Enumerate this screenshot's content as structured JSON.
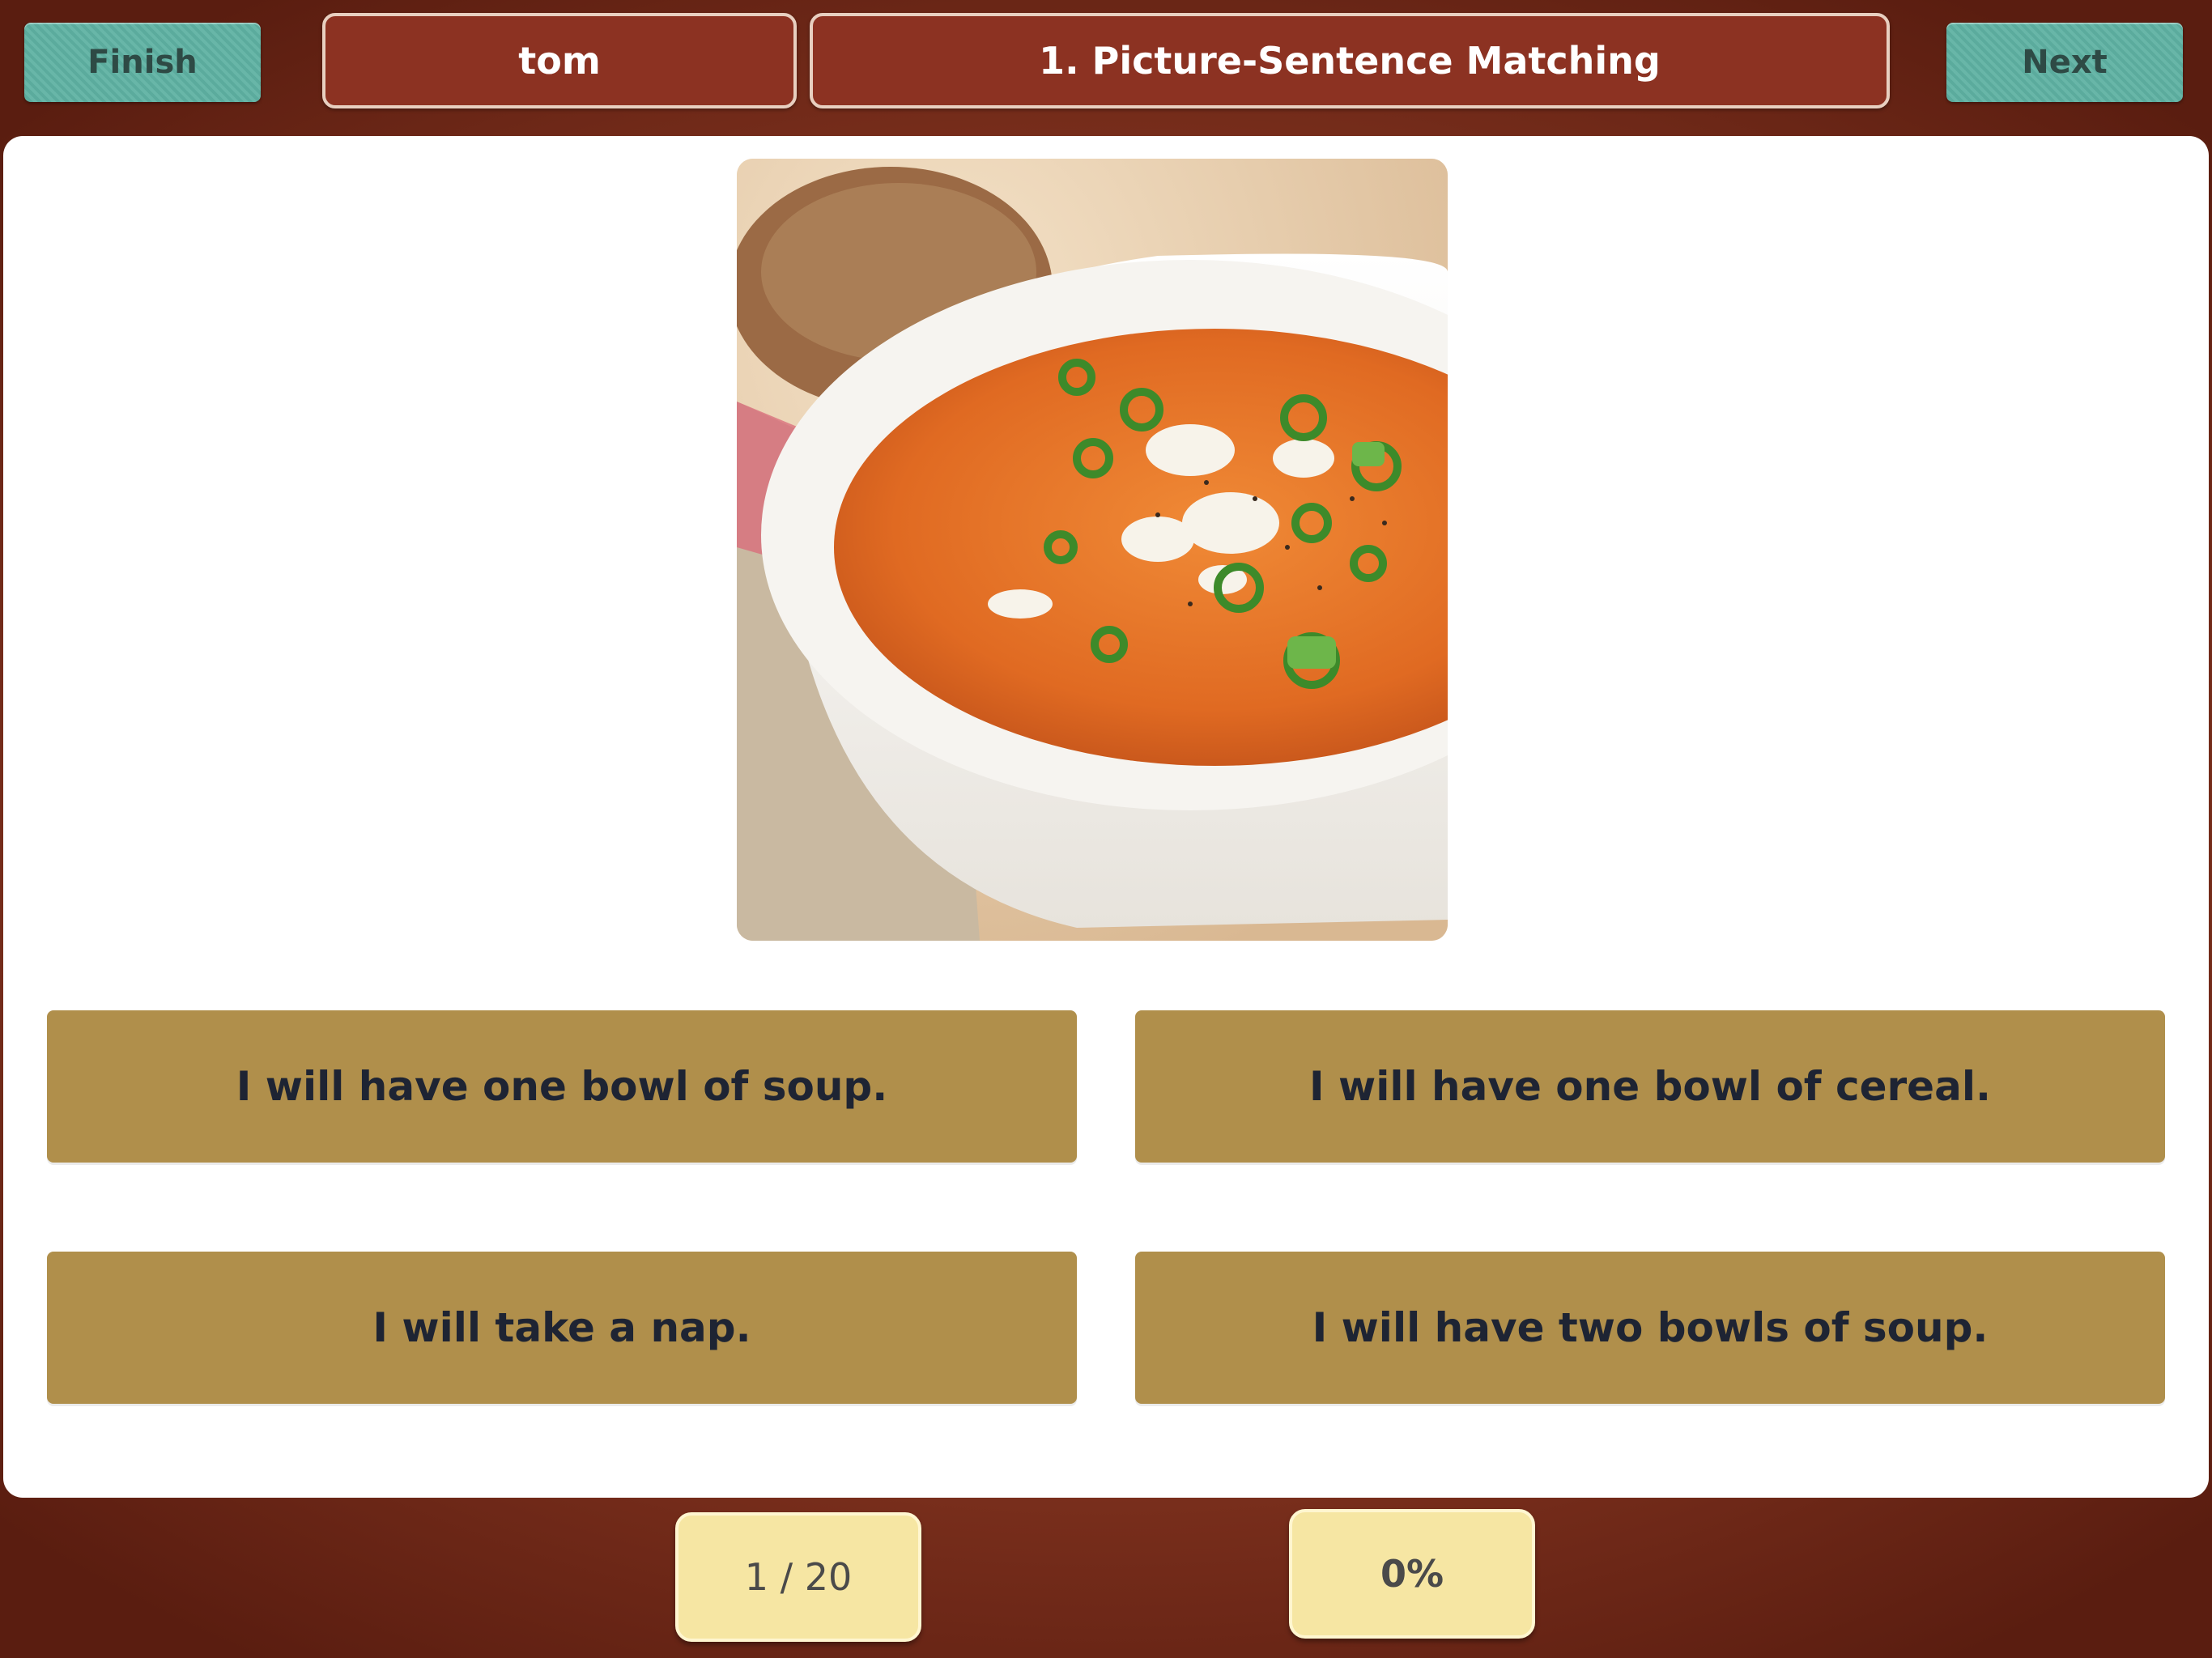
{
  "header": {
    "finish_label": "Finish",
    "user_name": "tom",
    "activity_title": "1. Picture-Sentence Matching",
    "next_label": "Next"
  },
  "picture": {
    "subject": "bowl of tomato soup with scallions and crumbled cheese",
    "icon": "soup-photo"
  },
  "options": [
    {
      "label": "I will have one bowl of soup."
    },
    {
      "label": "I will have one bowl of cereal."
    },
    {
      "label": "I will take a nap."
    },
    {
      "label": "I will have two bowls of soup."
    }
  ],
  "footer": {
    "progress": "1 / 20",
    "score": "0%"
  },
  "colors": {
    "background": "#8e3a24",
    "teal_button": "#5fb2a3",
    "title_box": "#8c3222",
    "option": "#b08f4b",
    "counter": "#f6e6a3"
  }
}
